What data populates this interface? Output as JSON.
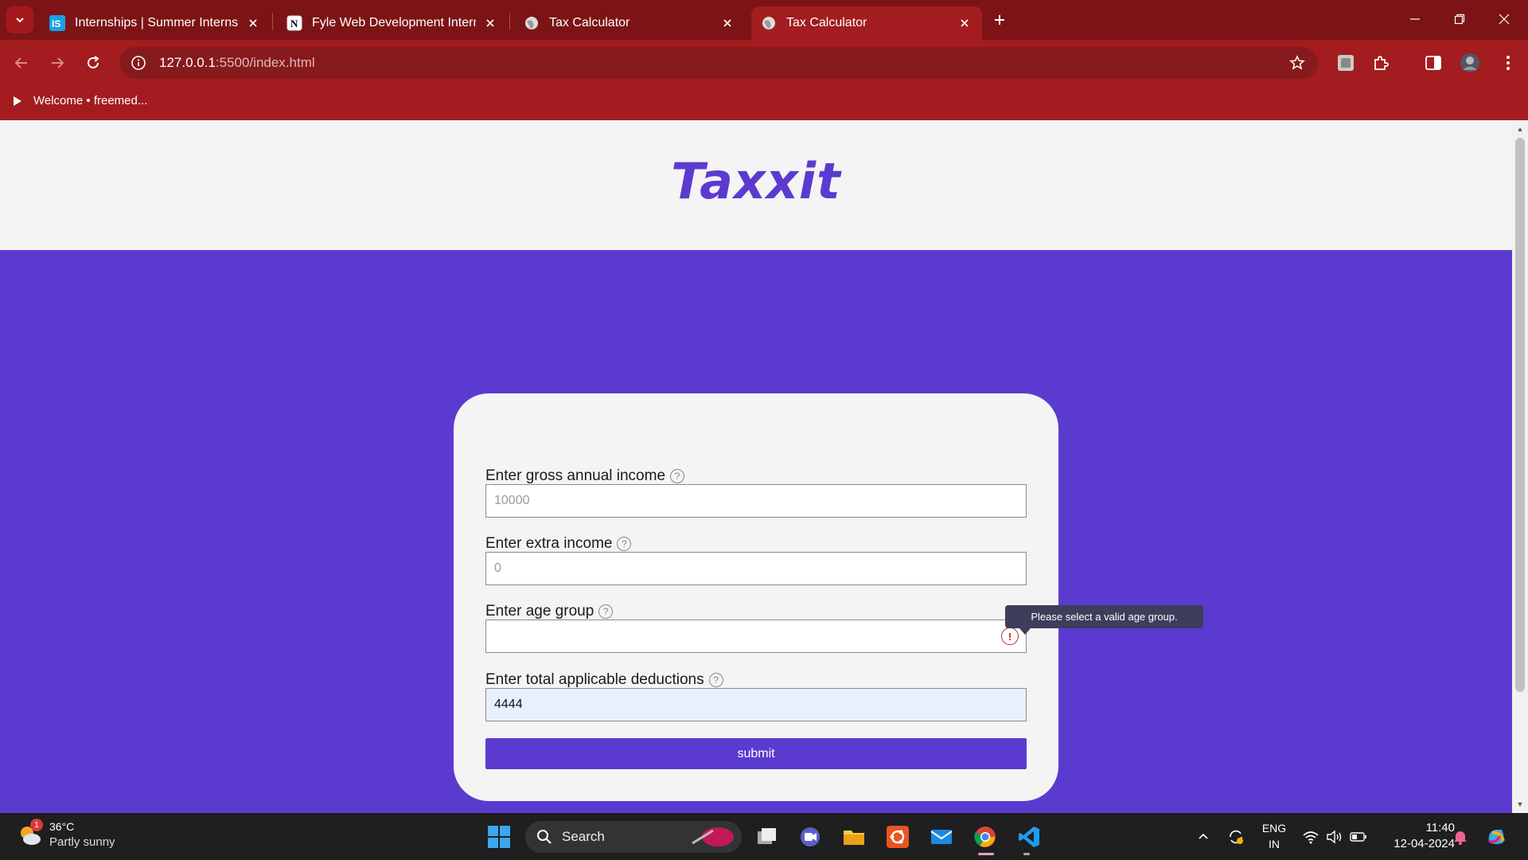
{
  "browser": {
    "tabs": [
      {
        "title": "Internships | Summer Internship",
        "favicon": "internshala-icon"
      },
      {
        "title": "Fyle Web Development Internsh",
        "favicon": "notion-icon"
      },
      {
        "title": "Tax Calculator",
        "favicon": "globe-icon"
      },
      {
        "title": "Tax Calculator",
        "favicon": "globe-icon",
        "active": true
      }
    ],
    "address": {
      "host": "127.0.0.1",
      "rest": ":5500/index.html"
    },
    "bookmark": "Welcome • freemed..."
  },
  "page": {
    "brand": "Taxxit",
    "form": {
      "gross_label": "Enter gross annual income",
      "gross_placeholder": "10000",
      "extra_label": "Enter extra income",
      "extra_placeholder": "0",
      "age_label": "Enter age group",
      "age_value": "",
      "deductions_label": "Enter total applicable deductions",
      "deductions_value": "4444",
      "submit_label": "submit",
      "help_glyph": "?",
      "invalid_glyph": "!"
    },
    "validation_tooltip": "Please select a valid age group."
  },
  "taskbar": {
    "weather": {
      "temp": "36°C",
      "condition": "Partly sunny",
      "badge": "1"
    },
    "search_label": "Search",
    "lang": {
      "line1": "ENG",
      "line2": "IN"
    },
    "clock": {
      "time": "11:40",
      "date": "12-04-2024"
    }
  },
  "colors": {
    "brand": "#5b3bcf",
    "chrome": "#a31c1f",
    "tabbar": "#7c1416",
    "invalid": "#c62828"
  }
}
